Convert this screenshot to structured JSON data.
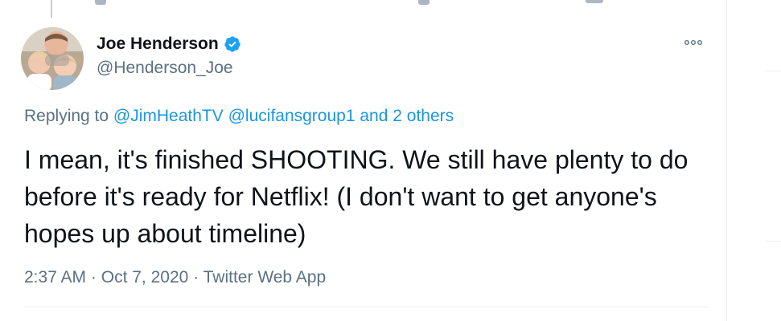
{
  "author": {
    "display_name": "Joe Henderson",
    "handle": "@Henderson_Joe",
    "verified": true
  },
  "reply": {
    "prefix": "Replying to",
    "mention1": "@JimHeathTV",
    "mention2": "@lucifansgroup1",
    "and_text": "and",
    "others": "2 others"
  },
  "tweet": {
    "text": "I mean, it's finished SHOOTING. We still have plenty to do before it's ready for Netflix! (I don't want to get anyone's hopes up about timeline)"
  },
  "meta": {
    "time": "2:37 AM",
    "date": "Oct 7, 2020",
    "source": "Twitter Web App",
    "separator": "·"
  },
  "icons": {
    "more": "more-options-icon",
    "verified": "verified-badge-icon"
  },
  "colors": {
    "link": "#1b95e0",
    "verified": "#1da1f2",
    "muted": "#5b7083",
    "text": "#0f1419",
    "border": "#ebeef0"
  }
}
